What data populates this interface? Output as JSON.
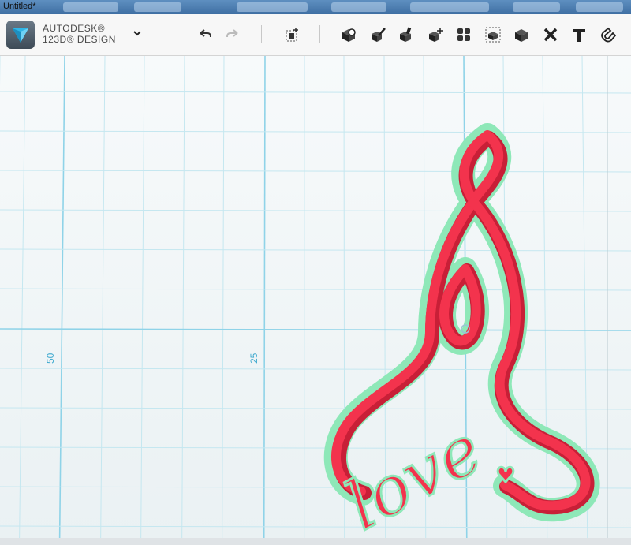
{
  "window": {
    "title": "Untitled*"
  },
  "brand": {
    "line1": "AUTODESK®",
    "line2": "123D® DESIGN"
  },
  "toolbar": {
    "menu_icon": "chevron-down-icon",
    "tools": [
      "undo-icon",
      "redo-icon",
      "primitives-icon",
      "sketch-icon",
      "construct-icon",
      "modify-icon",
      "pattern-icon",
      "grouping-icon",
      "combine-icon",
      "measure-icon",
      "text-icon",
      "snap-icon"
    ]
  },
  "grid": {
    "label_50": "50",
    "label_25": "25"
  },
  "model": {
    "text": "love",
    "color": "#f0304a",
    "outline_color": "#7fe3b0"
  },
  "colors": {
    "grid_major": "#8fd3e8",
    "grid_minor": "#c5e7f0",
    "background": "#f0f6f8"
  }
}
